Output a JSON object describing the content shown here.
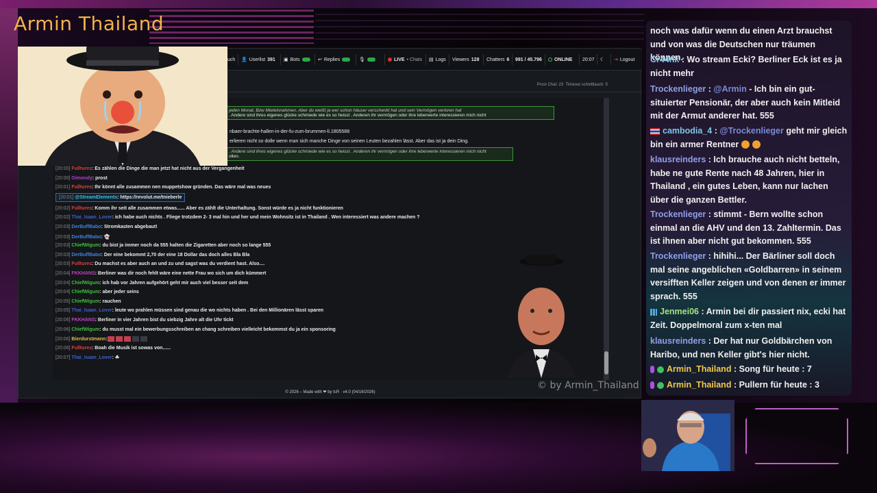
{
  "stream": {
    "title": "Armin Thailand",
    "watermark": "© by Armin_Thailand"
  },
  "navbar": {
    "items": [
      {
        "label": "uch",
        "icon": "search-icon"
      },
      {
        "label": "Userlist",
        "count": "391",
        "icon": "users-icon"
      },
      {
        "label": "Bots",
        "icon": "robot-icon",
        "toggle": true
      },
      {
        "label": "Replies",
        "icon": "reply-icon",
        "toggle": true
      },
      {
        "label": "",
        "icon": "mic-icon",
        "toggle": true
      },
      {
        "label": "LIVE",
        "sub": "• Chats",
        "icon": "live-dot-icon"
      },
      {
        "label": "Logs",
        "icon": "logs-icon"
      },
      {
        "label": "Viewers",
        "count": "128"
      },
      {
        "label": "Chatters",
        "count": "6"
      },
      {
        "label": "991 / 45.796"
      },
      {
        "label": "ONLINE",
        "icon": "online-icon"
      },
      {
        "label": "20:07"
      },
      {
        "label": "",
        "icon": "moon-icon"
      },
      {
        "label": "Logout",
        "icon": "logout-icon"
      }
    ]
  },
  "subbar": {
    "stats_prefix": "Prost Chat:",
    "stats_prost": "23",
    "stats_timeout_label": "Timeout schnittlauch:",
    "stats_timeout": "5"
  },
  "highlights": [
    {
      "italic": "jeden Monat. Bzw Mieteinnahmen. Aber du weißt ja wer schon häuser verschenkt hat und sein Vermögen verloren hat",
      "text": ". Andere sind ihres eigenes glücke schmiede wie es so heisst . Anderen ihr vermögen oder ihre leberwerte interessieren mich nicht"
    },
    {
      "italic": ". Andere sind ihres eigenes glücke schmiede wie es so heisst . Anderen ihr vermögen oder ihre leberwerte interessieren mich nicht",
      "text": "ollen."
    }
  ],
  "partial_lines": [
    "nbaer-brachte-hallen-in-der-fu-zum-brummen-li.1805588",
    "erlieren nicht so dolle wenn man sich manche Dinge von seinen Leuten bezahlen lässt. Aber das ist ja dein Ding."
  ],
  "chat": [
    {
      "ts": "[20:00]",
      "user": "Fulltures",
      "color": "#e04040",
      "text": ": Es zählen die Dinge die man jetzt hat nicht aus der Vergangenheit"
    },
    {
      "ts": "[20:00]",
      "user": "Oimondy",
      "color": "#b040d0",
      "text": ": prost"
    },
    {
      "ts": "[20:01]",
      "user": "Fulltures",
      "color": "#e04040",
      "text": ": Ihr könnt alle zusammen nen muppetshow gründen. Das wäre mal was neues"
    },
    {
      "ts": "[20:01]",
      "user": "@StreamElements",
      "color": "#40c0e0",
      "text": ": https://revolut.me/tnieberle",
      "se": true
    },
    {
      "ts": "[20:02]",
      "user": "Fulltures",
      "color": "#e04040",
      "text": ": Komm ihr seit alle zusammen etwas...... Aber es zählt die Unterhaltung. Sonst würde es ja nicht funktionieren"
    },
    {
      "ts": "[20:02]",
      "user": "Thai_Isaan_Lover",
      "color": "#4060d0",
      "text": ": ich habe auch nichts . Fliege trotzdem 2- 3 mal hin und her und mein Wohnsitz ist in Thailand . Wen interessiert was andere machen ?"
    },
    {
      "ts": "[20:03]",
      "user": "DerBuffBabo",
      "color": "#4080e0",
      "text": ": Stromkasten abgebaut!"
    },
    {
      "ts": "[20:03]",
      "user": "DerBuffBabo",
      "color": "#4080e0",
      "text": ": 👻"
    },
    {
      "ts": "[20:03]",
      "user": "ChiefWigum",
      "color": "#40c040",
      "text": ": du bist ja immer noch da 555 halten die Zigaretten aber noch so lange 555"
    },
    {
      "ts": "[20:03]",
      "user": "DerBuffBabo",
      "color": "#4080e0",
      "text": ": Der eine bekommt 2,70 der eine 18 Dollar das doch alles Bla Bla"
    },
    {
      "ts": "[20:03]",
      "user": "Fulltures",
      "color": "#e04040",
      "text": ": Du machst es aber auch an und zu und sagst was du verdient hast. Also...."
    },
    {
      "ts": "[20:04]",
      "user": "FKKHANS",
      "color": "#c040c0",
      "text": ": Berliner was dir noch fehlt wäre eine nette Frau wo sich um dich kümmert"
    },
    {
      "ts": "[20:04]",
      "user": "ChiefWigum",
      "color": "#40c040",
      "text": ": ich hab vor Jahren aufgehört geht mir auch viel besser seit dem"
    },
    {
      "ts": "[20:04]",
      "user": "ChiefWigum",
      "color": "#40c040",
      "text": ": aber jeder seins"
    },
    {
      "ts": "[20:05]",
      "user": "ChiefWigum",
      "color": "#40c040",
      "text": ": rauchen"
    },
    {
      "ts": "[20:05]",
      "user": "Thai_Isaan_Lover",
      "color": "#4060d0",
      "text": ": leute wo prahlen müssen sind genau die wo nichts haben . Bei den Millionären lässt sparen"
    },
    {
      "ts": "[20:06]",
      "user": "FKKHANS",
      "color": "#c040c0",
      "text": ": Berliner in vier Jahren bist du siebzig Jahre alt die Uhr tickt"
    },
    {
      "ts": "[20:06]",
      "user": "ChiefWigum",
      "color": "#40c040",
      "text": ": du musst mal ein bewerbungsschreiben an chang schreiben vielleicht bekommst du ja ein sponsoring"
    },
    {
      "ts": "[20:06]",
      "user": "Bierdurstmann",
      "color": "#e0c040",
      "text": ":"
    },
    {
      "ts": "[20:06]",
      "user": "Fulltures",
      "color": "#e04040",
      "text": ": Boah die Musik ist sowas von......"
    },
    {
      "ts": "[20:07]",
      "user": "Thai_Isaan_Lover",
      "color": "#4060d0",
      "text": ": ☘"
    }
  ],
  "footer": "© 2026 – Made with ❤ by tcR · v4.0 (04/16/2026)",
  "overlay": [
    {
      "user": "",
      "text": "noch was dafür wenn du einen Arzt brauchst und von was die Deutschen nur träumen können."
    },
    {
      "user": "Cr44nk",
      "cls": "u-teal",
      "text": " : Wo stream Ecki? Berliner Eck ist es ja nicht mehr"
    },
    {
      "user": "Trockenlieger",
      "cls": "u-blue",
      "mention": "@Armin",
      "text": " - Ich bin ein gut-situierter Pensionär, der aber auch kein Mitleid mit der Armut anderer hat. 555"
    },
    {
      "user": "cambodia_4",
      "cls": "u-teal",
      "badge": "flag",
      "mention": "@Trockenlieger",
      "text": " geht mir gleich bin ein armer Rentner"
    },
    {
      "user": "klausreinders",
      "cls": "u-blue",
      "text": " : Ich brauche auch nicht betteln, habe ne gute Rente nach 48 Jahren, hier in Thailand , ein gutes Leben, kann nur lachen über die ganzen Bettler."
    },
    {
      "user": "Trockenlieger",
      "cls": "u-blue",
      "text": " : stimmt - Bern wollte schon einmal an die AHV und den 13. Zahltermin. Das ist ihnen aber nicht gut bekommen. 555"
    },
    {
      "user": "Trockenlieger",
      "cls": "u-blue",
      "text": " : hihihi... Der Bärliner soll doch mal seine angeblichen «Goldbarren» in seinem versifften Keller zeigen und von denen er immer sprach. 555"
    },
    {
      "user": "Jenmei06",
      "cls": "u-green",
      "badge": "grid",
      "text": " : Armin bei dir passiert nix, ecki hat Zeit. Doppelmoral zum x-ten mal"
    },
    {
      "user": "klausreinders",
      "cls": "u-blue",
      "text": " : Der hat nur Goldbärchen von Haribo, und nen Keller gibt's hier nicht."
    },
    {
      "user": "Armin_Thailand",
      "cls": "u-gold",
      "badge": "mod",
      "text": " : Song für heute : 7"
    },
    {
      "user": "Armin_Thailand",
      "cls": "u-gold",
      "badge": "mod",
      "text": " : Pullern für heute : 3"
    }
  ]
}
